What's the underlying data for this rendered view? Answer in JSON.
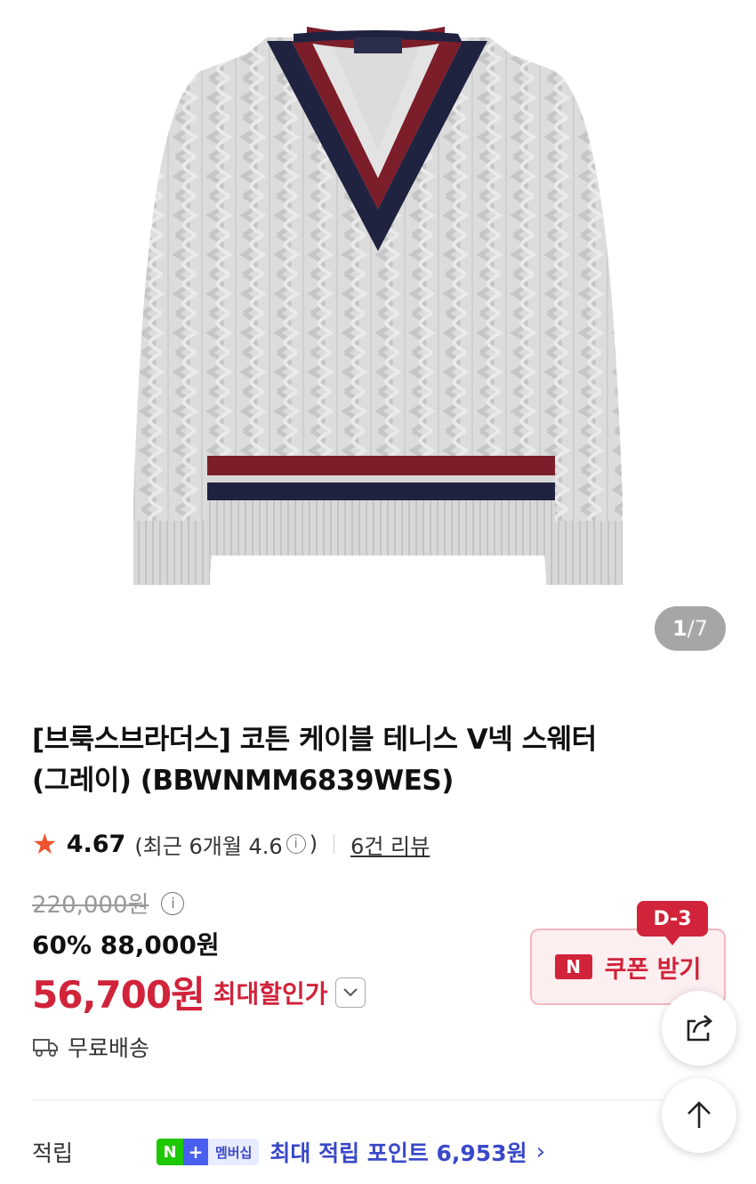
{
  "gallery": {
    "current": "1",
    "separator": "/",
    "total": "7"
  },
  "product": {
    "title_line1": "[브룩스브라더스] 코튼 케이블 테니스 V넥 스웨터",
    "title_line2": "(그레이) (BBWNMM6839WES)"
  },
  "rating": {
    "star": "★",
    "value": "4.67",
    "recent_prefix": "(최근 6개월 4.6",
    "recent_suffix": ")",
    "review_link": "6건 리뷰"
  },
  "price": {
    "original": "220,000원",
    "discount_line": "60% 88,000원",
    "final": "56,700원",
    "final_label": "최대할인가"
  },
  "coupon": {
    "dday": "D-3",
    "logo": "N",
    "label": "쿠폰 받기",
    "accent": "#d1233a"
  },
  "shipping": {
    "label": "무료배송"
  },
  "points": {
    "label": "적립",
    "badge_n": "N",
    "badge_plus": "+",
    "badge_membership": "멤버십",
    "text": "최대 적립 포인트 6,953원",
    "chevron": "›",
    "accent": "#3a48c9"
  },
  "icons": {
    "info": "i",
    "share": "share-icon",
    "scroll_top": "arrow-up-icon",
    "truck": "truck-icon"
  }
}
